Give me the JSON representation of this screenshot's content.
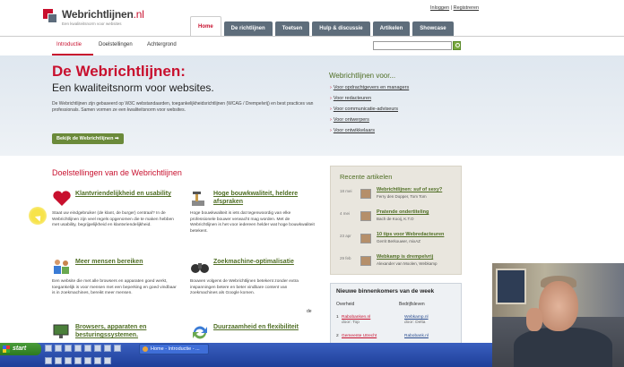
{
  "header": {
    "logo_title": "Webrichtlijnen",
    "logo_tld": ".nl",
    "logo_tagline": "Een kwaliteitsnorm voor websites",
    "login": "Inloggen",
    "separator": "|",
    "register": "Registreren"
  },
  "nav": {
    "tabs": [
      {
        "label": "Home"
      },
      {
        "label": "De richtlijnen"
      },
      {
        "label": "Toetsen"
      },
      {
        "label": "Hulp & discussie"
      },
      {
        "label": "Artikelen"
      },
      {
        "label": "Showcase"
      }
    ]
  },
  "subnav": {
    "items": [
      {
        "label": "Introductie"
      },
      {
        "label": "Doelstellingen"
      },
      {
        "label": "Achtergrond"
      }
    ],
    "search_placeholder": ""
  },
  "hero": {
    "title": "De Webrichtlijnen:",
    "subtitle": "Een kwaliteitsnorm voor websites.",
    "intro": "De Webrichtlijnen zijn gebaseerd op W3C webstandaarden, toegankelijkheidsrichtlijnen (WCAG / Drempelvrij) en best practices van professionals. Samen vormen ze een kwaliteitsnorm voor websites.",
    "button": "Bekijk de Webrichtlijnen",
    "aside_title": "Webrichtlijnen voor...",
    "aside_links": [
      "Voor opdrachtgevers en managers",
      "Voor redacteuren",
      "Voor communicatie-adviseurs",
      "Voor ontwerpers",
      "Voor ontwikkelaars"
    ]
  },
  "main": {
    "section_title": "Doelstellingen van de Webrichtlijnen",
    "features": [
      {
        "title": "Klantvriendelijkheid en usability",
        "body": "Staat uw eindgebruiker (de klant, de burger) centraal? In de Webrichtlijnen zijn veel regels opgenomen die te maken hebben met usability, begrijpelijkheid en klantvriendelijkheid."
      },
      {
        "title": "Hoge bouwkwaliteit, heldere afspraken",
        "body": "Hoge bouwkwaliteit is iets dat tegenwoordig van elke professionele bouwer verwacht mag worden. Met de Webrichtlijnen is het voor iedereen helder wat hoge bouwkwaliteit betekent."
      },
      {
        "title": "Meer mensen bereiken",
        "body": "Een website die met alle browsers en apparaten goed werkt, toegankelijk is voor mensen met een beperking en goed vindbaar is in zoekmachines, bereikt meer mensen."
      },
      {
        "title": "Zoekmachine-optimalisatie",
        "body": "Bouwen volgens de Webrichtlijnen betekent zonder extra inspanningen betere en beter vindbare content van zoekmachines als Google komen."
      },
      {
        "title": "Browsers, apparaten en besturingssystemen.",
        "body": ""
      },
      {
        "title": "Duurzaamheid en flexibiliteit",
        "body": ""
      }
    ],
    "stray_text": "de"
  },
  "recent": {
    "title": "Recente artikelen",
    "items": [
      {
        "date": "18 mei",
        "title": "Webrichtlijnen: suf of sexy?",
        "sub": "Ferry den Dopper, Tom Tom"
      },
      {
        "date": "4 mei",
        "title": "Pratende ondertiteling",
        "sub": "Bach de Kooij, K.T.O"
      },
      {
        "date": "23 apr",
        "title": "10 tips voor Webredacteuren",
        "sub": "Gerrit Berkouwer, mixAZ"
      },
      {
        "date": "29 feb",
        "title": "Webkamp is drempelvrij",
        "sub": "Alexander van Moolen, Webkamp"
      }
    ]
  },
  "newcomers": {
    "title": "Nieuwe binnenkomers van de week",
    "col_overview": "Overheid",
    "col_company": "Bedrijfsleven",
    "rows": [
      {
        "num": "1",
        "gov": "Rabobanken.nl",
        "gov_sub": "door: Top",
        "comp": "Webkamp.nl",
        "comp_sub": "door: Delta"
      },
      {
        "num": "2",
        "gov": "Gemeente Utrecht",
        "gov_sub": "",
        "comp": "Rabobank.nl",
        "comp_sub": ""
      }
    ]
  },
  "taskbar": {
    "start": "start",
    "task": "Home - Introductie - ..."
  }
}
